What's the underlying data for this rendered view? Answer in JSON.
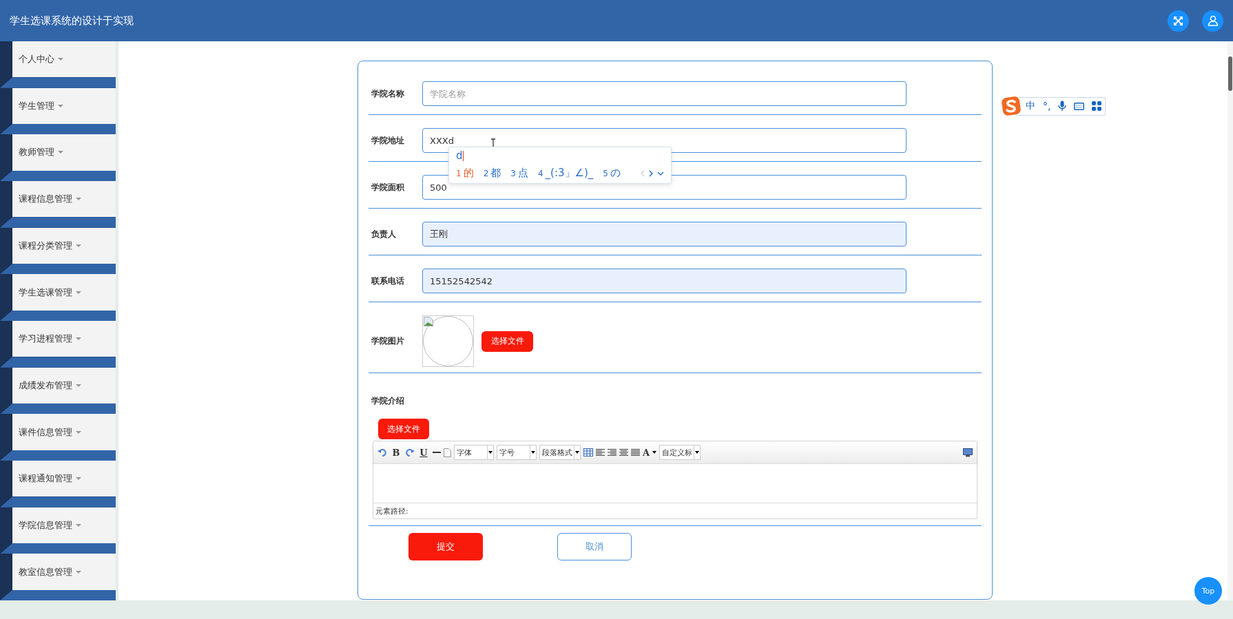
{
  "header": {
    "title": "学生选课系统的设计于实现"
  },
  "sidebar": {
    "items": [
      {
        "label": "个人中心"
      },
      {
        "label": "学生管理"
      },
      {
        "label": "教师管理"
      },
      {
        "label": "课程信息管理"
      },
      {
        "label": "课程分类管理"
      },
      {
        "label": "学生选课管理"
      },
      {
        "label": "学习进程管理"
      },
      {
        "label": "成绩发布管理"
      },
      {
        "label": "课件信息管理"
      },
      {
        "label": "课程通知管理"
      },
      {
        "label": "学院信息管理"
      },
      {
        "label": "教室信息管理"
      }
    ]
  },
  "form": {
    "fields": [
      {
        "label": "学院名称",
        "placeholder": "学院名称",
        "autofilled": false
      },
      {
        "label": "学院地址",
        "value": "XXXd",
        "autofilled": false
      },
      {
        "label": "学院面积",
        "value": "500",
        "autofilled": false
      },
      {
        "label": "负责人",
        "value": "王刚",
        "autofilled": true
      },
      {
        "label": "联系电话",
        "value": "15152542542",
        "autofilled": true
      }
    ],
    "image": {
      "label": "学院图片",
      "button": "选择文件"
    },
    "intro": {
      "label": "学院介绍",
      "button": "选择文件",
      "editor": {
        "toolbar": [
          {
            "kind": "undo"
          },
          {
            "kind": "glyph",
            "text": "B"
          },
          {
            "kind": "redo"
          },
          {
            "kind": "underline",
            "text": "U"
          },
          {
            "kind": "hr"
          },
          {
            "kind": "page"
          },
          {
            "kind": "select",
            "text": "字体"
          },
          {
            "kind": "select",
            "text": "字号"
          },
          {
            "kind": "select",
            "text": "段落格式"
          },
          {
            "kind": "table"
          },
          {
            "kind": "align-left"
          },
          {
            "kind": "align-right"
          },
          {
            "kind": "align-center"
          },
          {
            "kind": "justify"
          },
          {
            "kind": "color",
            "text": "A"
          },
          {
            "kind": "select",
            "text": "自定义标"
          }
        ],
        "status": "元素路径:"
      }
    },
    "actions": [
      {
        "label": "提交",
        "kind": "primary"
      },
      {
        "label": "取消",
        "kind": "secondary"
      }
    ]
  },
  "ime_popup": {
    "composition": "d",
    "candidates": [
      {
        "index": "1",
        "text": "的",
        "selected": true
      },
      {
        "index": "2",
        "text": "都",
        "selected": false
      },
      {
        "index": "3",
        "text": "点",
        "selected": false
      },
      {
        "index": "4",
        "text": "_(:3」∠)_",
        "selected": false
      },
      {
        "index": "5",
        "text": "の",
        "selected": false
      }
    ]
  },
  "ime_toolbar": {
    "mode": "中",
    "punctuation": "°,"
  },
  "back_to_top": {
    "label": "Top"
  }
}
